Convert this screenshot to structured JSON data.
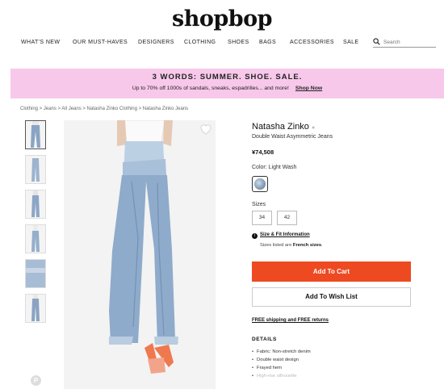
{
  "header": {
    "logo": "shopbop",
    "nav": [
      "WHAT'S NEW",
      "OUR MUST-HAVES",
      "DESIGNERS",
      "CLOTHING",
      "SHOES",
      "BAGS",
      "ACCESSORIES",
      "SALE"
    ],
    "search_placeholder": "Search"
  },
  "banner": {
    "headline": "3 WORDS: SUMMER. SHOE. SALE.",
    "subtext": "Up to 70% off 1000s of sandals, sneaks, espadrilles... and more!",
    "cta": "Shop Now",
    "bg_color": "#f7c8ea"
  },
  "breadcrumb": "Clothing > Jeans > All Jeans > Natasha Zinko Clothing > Natasha Zinko Jeans",
  "product": {
    "brand": "Natasha Zinko",
    "name": "Double Waist Asymmetric Jeans",
    "price": "¥74,508",
    "color_label": "Color: Light Wash",
    "sizes_label": "Sizes",
    "sizes": [
      "34",
      "42"
    ],
    "size_fit_link": "Size & Fit Information",
    "size_note_prefix": "Sizes listed are ",
    "size_note_bold": "French sizes",
    "size_note_suffix": ".",
    "add_to_cart": "Add To Cart",
    "add_to_wishlist": "Add To Wish List",
    "shipping_link": "FREE shipping and FREE returns",
    "details_title": "DETAILS",
    "details": [
      "Fabric: Non-stretch denim",
      "Double waist design",
      "Frayed hem",
      "High-rise silhouette"
    ]
  },
  "colors": {
    "accent": "#ee4a22"
  },
  "icons": [
    "search-icon",
    "heart-icon",
    "pinterest-icon",
    "info-icon"
  ]
}
